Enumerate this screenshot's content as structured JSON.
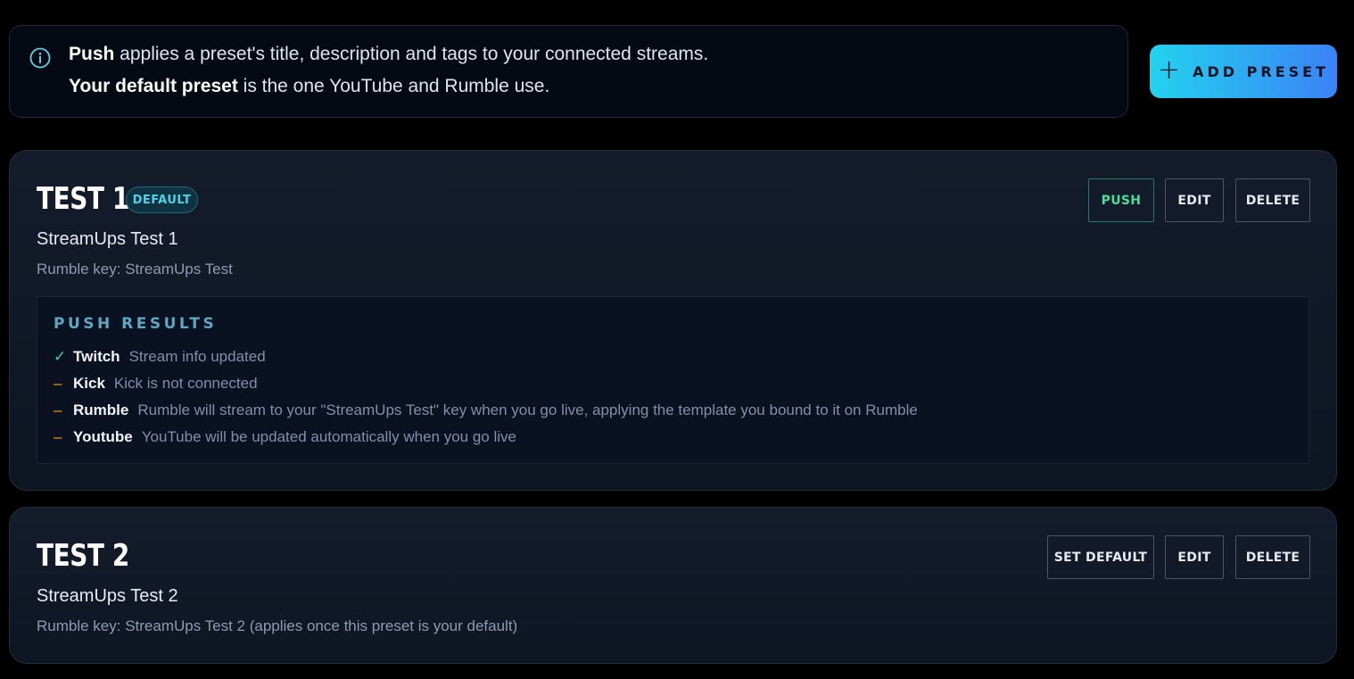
{
  "info": {
    "line1_strong": "Push",
    "line1_rest": " applies a preset's title, description and tags to your connected streams.",
    "line2_strong": "Your default preset",
    "line2_rest": " is the one YouTube and Rumble use."
  },
  "add_button": {
    "label": "ADD PRESET",
    "icon": "+"
  },
  "presets": [
    {
      "title": "TEST 1",
      "badge": "DEFAULT",
      "subtitle": "StreamUps Test 1",
      "meta": "Rumble key: StreamUps Test",
      "actions": [
        "PUSH",
        "EDIT",
        "DELETE"
      ],
      "results": {
        "heading": "PUSH RESULTS",
        "rows": [
          {
            "mark": "✓",
            "status": "ok",
            "platform": "Twitch",
            "message": "Stream info updated"
          },
          {
            "mark": "–",
            "status": "pending",
            "platform": "Kick",
            "message": "Kick is not connected"
          },
          {
            "mark": "–",
            "status": "pending",
            "platform": "Rumble",
            "message": "Rumble will stream to your \"StreamUps Test\" key when you go live, applying the template you bound to it on Rumble"
          },
          {
            "mark": "–",
            "status": "pending",
            "platform": "Youtube",
            "message": "YouTube will be updated automatically when you go live"
          }
        ]
      }
    },
    {
      "title": "TEST 2",
      "subtitle": "StreamUps Test 2",
      "meta": "Rumble key: StreamUps Test 2 (applies once this preset is your default)",
      "actions": [
        "SET DEFAULT",
        "EDIT",
        "DELETE"
      ]
    }
  ],
  "colors": {
    "accent_start": "#22d3ee",
    "accent_end": "#3b82f6",
    "ok": "#34d399",
    "pending": "#f59e0b"
  }
}
